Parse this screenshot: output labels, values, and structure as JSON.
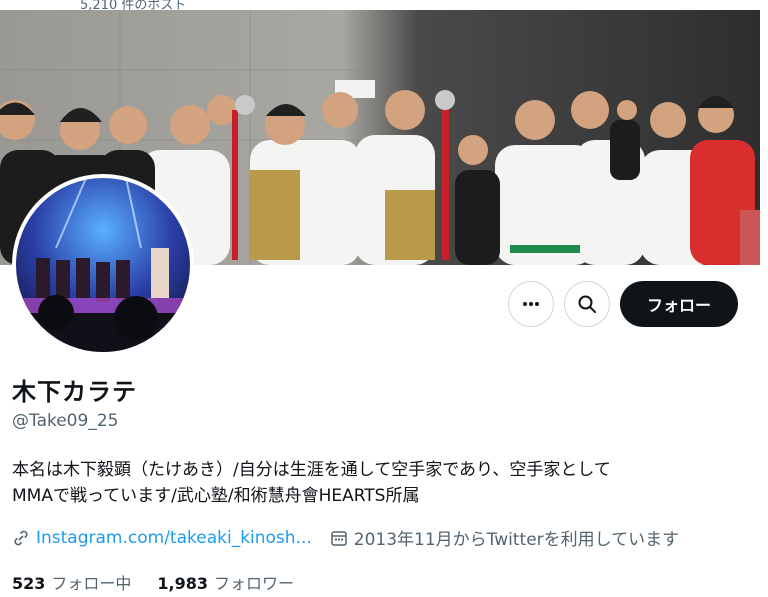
{
  "header": {
    "post_count": "5,210 件のポスト"
  },
  "profile": {
    "name": "木下カラテ",
    "handle": "@Take09_25",
    "bio_line1": "本名は木下毅顕（たけあき）/自分は生涯を通して空手家であり、空手家として",
    "bio_line2": "MMAで戦っています/武心塾/和術慧舟會HEARTS所属",
    "link_text": "Instagram.com/takeaki_kinosh...",
    "joined": "2013年11月からTwitterを利用しています",
    "following_count": "523",
    "following_label": "フォロー中",
    "followers_count": "1,983",
    "followers_label": "フォロワー"
  },
  "actions": {
    "more_icon": "more-icon",
    "search_icon": "search-icon",
    "follow_label": "フォロー"
  },
  "colors": {
    "link": "#1d9bf0",
    "secondary_text": "#536471",
    "follow_bg": "#0f1419"
  }
}
